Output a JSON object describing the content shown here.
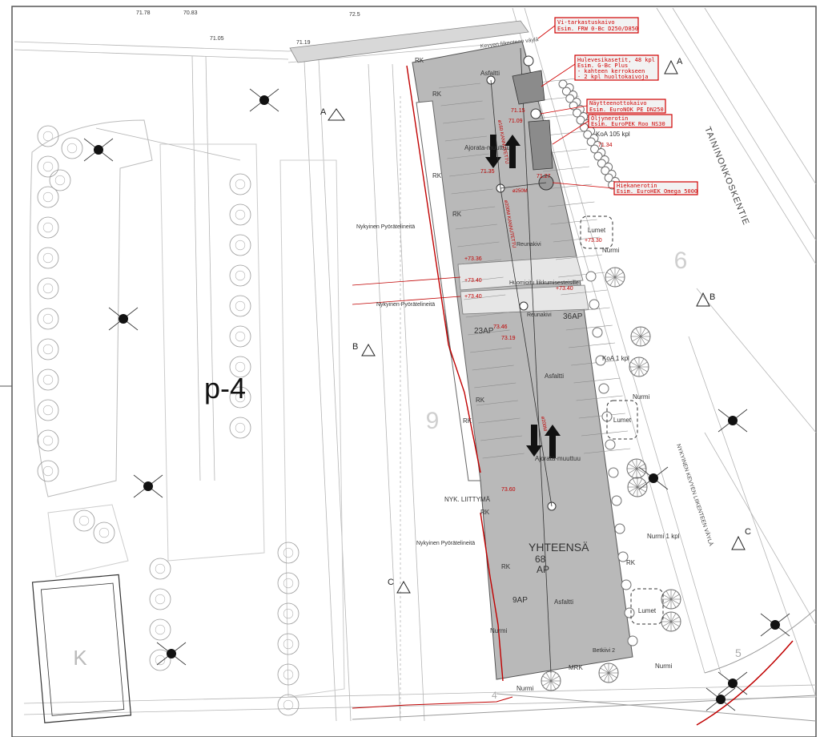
{
  "plan": {
    "block_label": "p-4",
    "block_number": "9",
    "building_letter": "K",
    "street_name": "TAININONKOSKENTIE",
    "side_area_number": "6",
    "bottom_right_number": "5",
    "bottom_left_number": "4",
    "road_label": "NYKYINEN KEVYEN LIIKENTEEN VÄYLÄ",
    "top_path_label": "Kevyen liikenteen väylä",
    "total_label": "YHTEENSÄ",
    "total_ap": "68",
    "ap_unit": "AP",
    "parking_counts": [
      "23AP",
      "36AP",
      "9AP"
    ],
    "section_markers": [
      "A",
      "A",
      "B",
      "B",
      "C",
      "C"
    ]
  },
  "callouts": [
    {
      "line1": "Vi-tarkastuskaivo",
      "line2": "Esim. FRW 0-Bc D250/D850"
    },
    {
      "line1": "Hulevesikasetit, 48 kpl",
      "line2": "Esim. G-Bc Plus",
      "line3": "- kahteen kerrokseen",
      "line4": "- 2 kpl huoltokaivoja"
    },
    {
      "line1": "Näytteenottokaivo",
      "line2": "Esim. EuroNOK PE DN250"
    },
    {
      "line1": "Öljynerotin",
      "line2": "Esim. EuroPEK Roo NS30"
    },
    {
      "line1": "Hiekanerotin",
      "line2": "Esim. EuroHEK Omega 5000"
    }
  ],
  "area_labels": {
    "asphalt": "Asfaltti",
    "driving_lane": "Ajorata-muuttuu",
    "curb": "Reunakivi",
    "lawn": "Nurmi",
    "snow": "Lumet",
    "existing_bike_parking": "Nykyinen Pyörätelineitä",
    "existing_connection": "NYK. LIITTYMÄ",
    "disabled_spot": "Huomioitu liikkumisesteisille",
    "koa_105": "KoA 105 kpl",
    "koa_1": "KoA 1 kpl",
    "nurmi_kpl": "Nurmi 1 kpl",
    "rk": "RK",
    "mrk": "MRK",
    "bench": "Betkiivi 2"
  },
  "elevations": [
    "+73.36",
    "+73.40",
    "+73.40",
    "+73.40",
    "+73.30",
    "73.46",
    "73.19",
    "71.35",
    "71.27",
    "71.15",
    "71.09",
    "71.34",
    "73.60",
    "70.83",
    "71.19",
    "71.05",
    "72.5",
    "71.78"
  ],
  "pipe_labels": [
    "ø250M",
    "ø160 KANNUTETTU",
    "ø200M KANNUTETTU",
    "ø200M"
  ],
  "colors": {
    "paving": "#b9b9b9",
    "callout_border": "#d00000",
    "boundary": "#c00000",
    "lines": "#9a9a9a",
    "trees": "#6e6e6e"
  }
}
